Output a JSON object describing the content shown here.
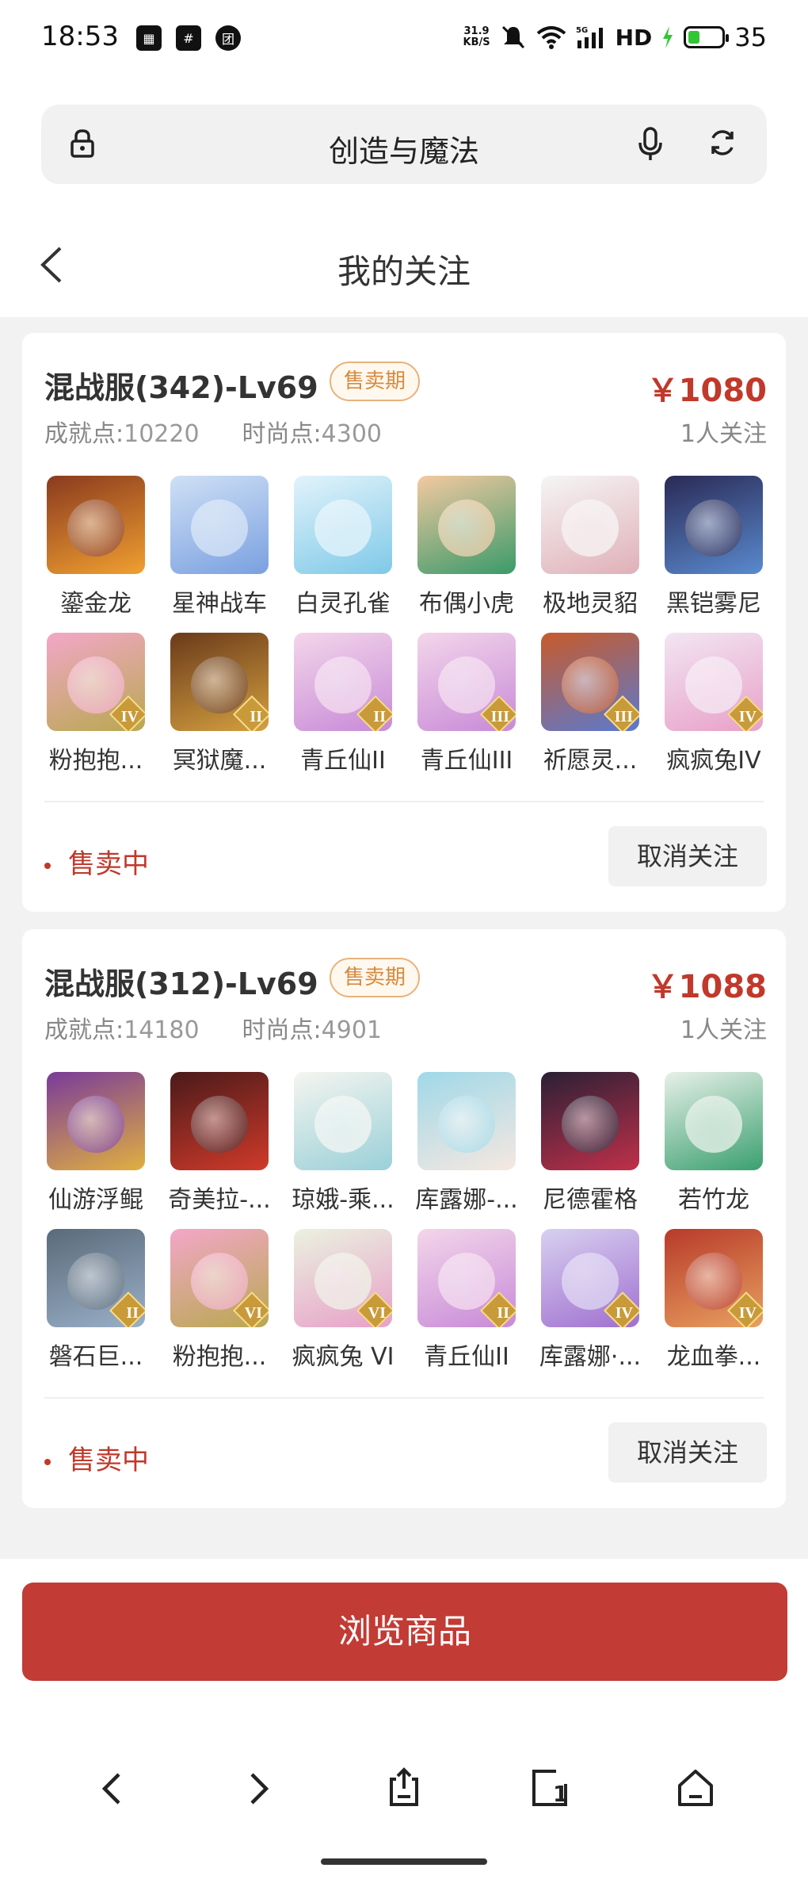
{
  "status_bar": {
    "time": "18:53",
    "app_icons": [
      "app-icon-1",
      "grid-app-icon",
      "tuan-app-icon"
    ],
    "net_speed_value": "31.9",
    "net_speed_unit": "KB/S",
    "hd_label": "HD",
    "battery_level": 35,
    "battery_text": "35"
  },
  "url_bar": {
    "title": "创造与魔法"
  },
  "header": {
    "title": "我的关注"
  },
  "listings": [
    {
      "server": "混战服(342)-Lv69",
      "tag": "售卖期",
      "price": "￥1080",
      "achievement_label": "成就点:",
      "achievement_value": "10220",
      "fashion_label": "时尚点:",
      "fashion_value": "4300",
      "followers": "1人关注",
      "status": "售卖中",
      "unfollow_label": "取消关注",
      "items": [
        {
          "name": "鎏金龙",
          "color": "#8a3a1e",
          "accent": "#f0a030",
          "badge": ""
        },
        {
          "name": "星神战车",
          "color": "#cfe0f5",
          "accent": "#7aa0e0",
          "badge": ""
        },
        {
          "name": "白灵孔雀",
          "color": "#e2f3fb",
          "accent": "#7fc9e8",
          "badge": ""
        },
        {
          "name": "布偶小虎",
          "color": "#f4c9a0",
          "accent": "#3a9a6a",
          "badge": ""
        },
        {
          "name": "极地灵貂",
          "color": "#f5f5f5",
          "accent": "#e0b0b8",
          "badge": ""
        },
        {
          "name": "黑铠雾尼",
          "color": "#2a2a55",
          "accent": "#5a8acf",
          "badge": ""
        },
        {
          "name": "粉抱抱...",
          "color": "#f3a7c8",
          "accent": "#b8a850",
          "badge": "IV"
        },
        {
          "name": "冥狱魔...",
          "color": "#6a3a1a",
          "accent": "#d4a040",
          "badge": "II"
        },
        {
          "name": "青丘仙II",
          "color": "#f3d6ea",
          "accent": "#c88ad8",
          "badge": "II"
        },
        {
          "name": "青丘仙III",
          "color": "#f3d6ea",
          "accent": "#c88ad8",
          "badge": "III"
        },
        {
          "name": "祈愿灵...",
          "color": "#c85a2a",
          "accent": "#5a7ad0",
          "badge": "III"
        },
        {
          "name": "疯疯兔IV",
          "color": "#f2e6f3",
          "accent": "#e8a0c8",
          "badge": "IV"
        }
      ]
    },
    {
      "server": "混战服(312)-Lv69",
      "tag": "售卖期",
      "price": "￥1088",
      "achievement_label": "成就点:",
      "achievement_value": "14180",
      "fashion_label": "时尚点:",
      "fashion_value": "4901",
      "followers": "1人关注",
      "status": "售卖中",
      "unfollow_label": "取消关注",
      "items": [
        {
          "name": "仙游浮鲲",
          "color": "#7a3a9a",
          "accent": "#e0b040",
          "badge": ""
        },
        {
          "name": "奇美拉-...",
          "color": "#4a1a1a",
          "accent": "#d03a2a",
          "badge": ""
        },
        {
          "name": "琼娥-乘...",
          "color": "#f5f5f0",
          "accent": "#9ad0d8",
          "badge": ""
        },
        {
          "name": "库露娜-...",
          "color": "#a0d8e8",
          "accent": "#f5e8e0",
          "badge": ""
        },
        {
          "name": "尼德霍格",
          "color": "#2a2035",
          "accent": "#c0304a",
          "badge": ""
        },
        {
          "name": "若竹龙",
          "color": "#e8f0e8",
          "accent": "#3aa070",
          "badge": ""
        },
        {
          "name": "磐石巨...",
          "color": "#5a6a7a",
          "accent": "#9ab0c8",
          "badge": "II"
        },
        {
          "name": "粉抱抱...",
          "color": "#f3a7c8",
          "accent": "#b8a850",
          "badge": "VI"
        },
        {
          "name": "疯疯兔 VI",
          "color": "#eaf2e0",
          "accent": "#e8a0c8",
          "badge": "VI"
        },
        {
          "name": "青丘仙II",
          "color": "#f3d6ea",
          "accent": "#c88ad8",
          "badge": "II"
        },
        {
          "name": "库露娜·...",
          "color": "#d8d0f0",
          "accent": "#a070d0",
          "badge": "IV"
        },
        {
          "name": "龙血拳...",
          "color": "#b83a2a",
          "accent": "#e8a060",
          "badge": "IV"
        }
      ]
    }
  ],
  "browse_button": "浏览商品",
  "bottom_nav": [
    "back-icon",
    "forward-icon",
    "share-icon",
    "tabs-icon",
    "home-icon"
  ],
  "tabs_count": "1"
}
